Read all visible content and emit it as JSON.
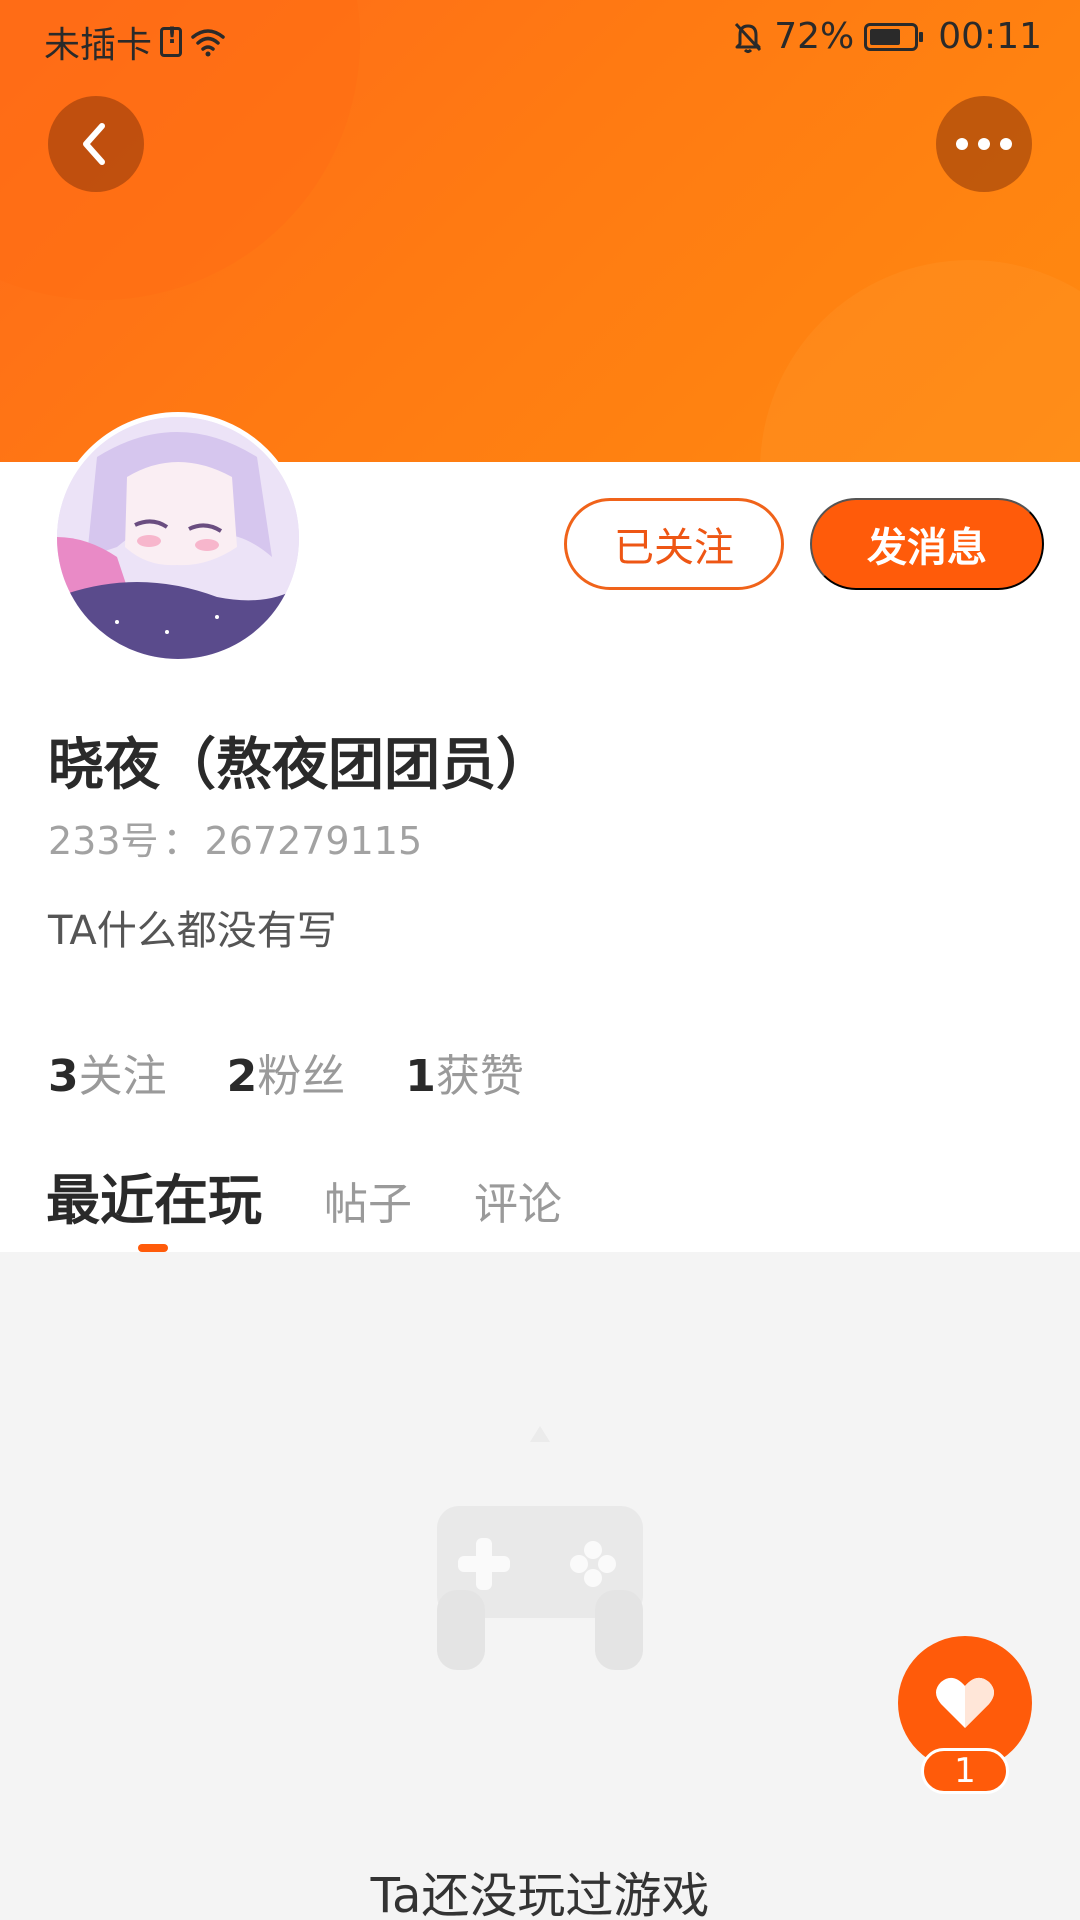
{
  "status_bar": {
    "carrier": "未插卡",
    "battery_percent": "72%",
    "battery_level": 0.72,
    "time": "00:11"
  },
  "header": {
    "back_icon": "chevron-left-icon",
    "more_icon": "more-dots-icon"
  },
  "profile": {
    "name": "晓夜（熬夜团团员）",
    "uid_label": "233号",
    "uid_separator": "：",
    "uid_value": "267279115",
    "bio": "TA什么都没有写",
    "follow_button": "已关注",
    "message_button": "发消息"
  },
  "stats": [
    {
      "count": "3",
      "label": "关注"
    },
    {
      "count": "2",
      "label": "粉丝"
    },
    {
      "count": "1",
      "label": "获赞"
    }
  ],
  "tabs": [
    {
      "label": "最近在玩",
      "active": true
    },
    {
      "label": "帖子",
      "active": false
    },
    {
      "label": "评论",
      "active": false
    }
  ],
  "empty_state": {
    "icon": "gamepad-icon",
    "text": "Ta还没玩过游戏"
  },
  "like_fab": {
    "icon": "heart-icon",
    "count": "1"
  },
  "colors": {
    "accent": "#ff5b0a",
    "banner": "#ff7a12"
  }
}
